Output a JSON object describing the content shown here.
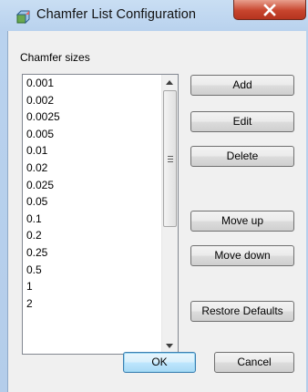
{
  "window": {
    "title": "Chamfer List Configuration",
    "close_label": "X"
  },
  "group": {
    "label": "Chamfer sizes"
  },
  "list": {
    "items": [
      "0.001",
      "0.002",
      "0.0025",
      "0.005",
      "0.01",
      "0.02",
      "0.025",
      "0.05",
      "0.1",
      "0.2",
      "0.25",
      "0.5",
      "1",
      "2"
    ],
    "scroll_position": 0
  },
  "buttons": {
    "add": "Add",
    "edit": "Edit",
    "delete": "Delete",
    "move_up": "Move up",
    "move_down": "Move down",
    "restore_defaults": "Restore Defaults",
    "ok": "OK",
    "cancel": "Cancel"
  },
  "colors": {
    "title_bar": "#b9d2ee",
    "close_button": "#c8452e",
    "default_button_border": "#3c7fb1"
  },
  "icons": {
    "title": "chamfer-app-icon",
    "close": "close-icon",
    "scroll_up": "up-arrow-icon",
    "scroll_down": "down-arrow-icon",
    "scroll_grip": "grip-icon"
  }
}
